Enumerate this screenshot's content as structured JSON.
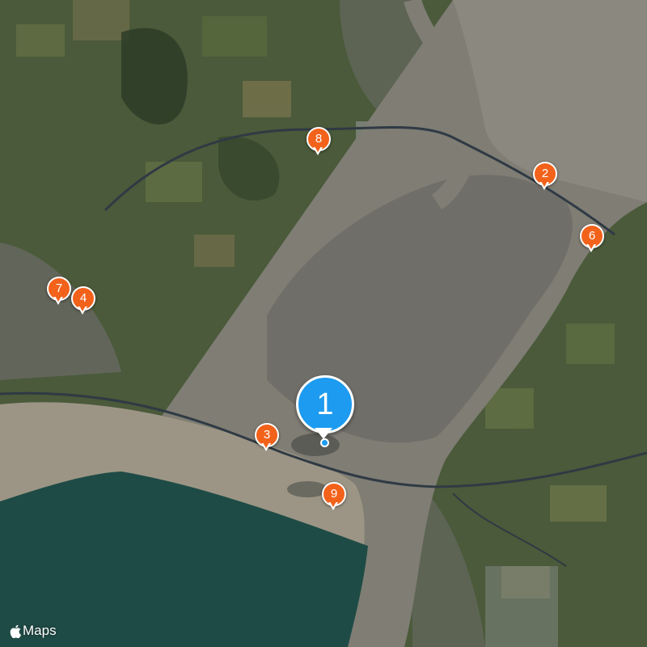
{
  "map": {
    "type": "satellite",
    "colors": {
      "water": "#1f4b46",
      "estuary": "#7f7d74",
      "mudflat": "#9c9585",
      "land": "#4a5a3a",
      "town": "#6b6a66",
      "bridge": "#2f3a44",
      "pin_orange": "#f2621b",
      "pin_blue": "#1c9bf0"
    }
  },
  "selected_pin": {
    "label": "1"
  },
  "pins": [
    {
      "label": "2"
    },
    {
      "label": "3"
    },
    {
      "label": "4"
    },
    {
      "label": "6"
    },
    {
      "label": "7"
    },
    {
      "label": "8"
    },
    {
      "label": "9"
    }
  ],
  "attribution": {
    "icon": "apple-logo-icon",
    "text": "Maps"
  }
}
